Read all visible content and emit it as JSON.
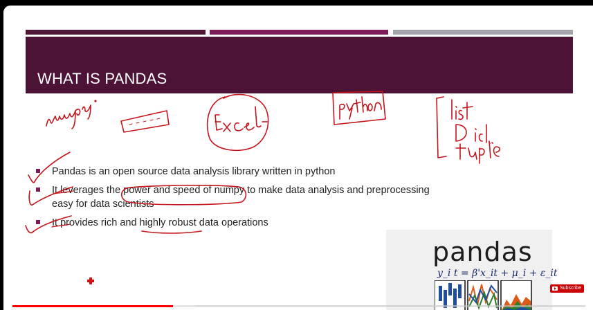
{
  "colors": {
    "stripe1": "#4e1536",
    "stripe2": "#7b1b58",
    "stripe3": "#a3a4ab",
    "banner": "#4d1336",
    "bullet": "#7b1b58",
    "ink": "#c4141c",
    "progress": "#ff0000"
  },
  "slide": {
    "title": "WHAT IS PANDAS",
    "bullets": [
      "Pandas is an open source data analysis library written in python",
      "It leverages the power and speed of numpy to make data analysis and preprocessing",
      "easy for data scientists",
      "It provides rich and highly robust data operations"
    ]
  },
  "annotations": [
    "numpy",
    "Excel",
    "python",
    "list",
    "Dict",
    "tuple"
  ],
  "logo": {
    "name": "pandas",
    "equation": "y_i t = β'x_it + μ_i + ε_it"
  },
  "overlay": {
    "subscribe_label": "Subscribe",
    "progress_fraction": 0.28,
    "buffer_fraction": 0.32
  }
}
